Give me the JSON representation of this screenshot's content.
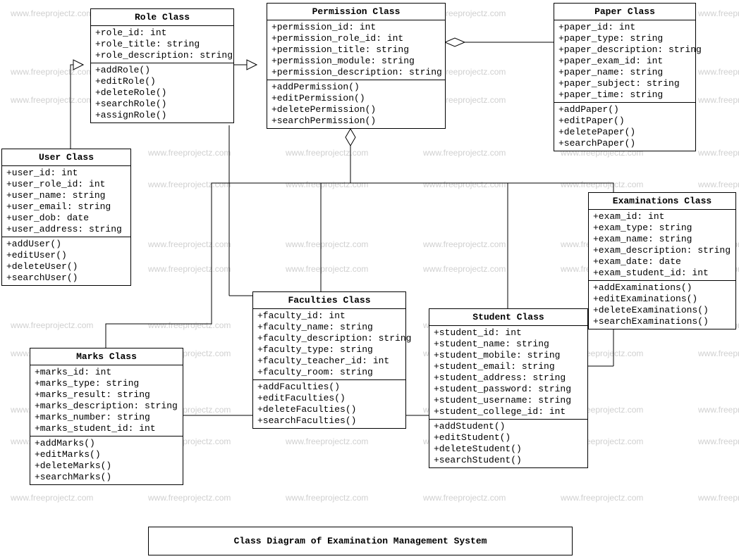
{
  "watermark": "www.freeprojectz.com",
  "caption": "Class Diagram of Examination Management System",
  "classes": {
    "role": {
      "title": "Role Class",
      "attrs": [
        "+role_id: int",
        "+role_title: string",
        "+role_description: string"
      ],
      "ops": [
        "+addRole()",
        "+editRole()",
        "+deleteRole()",
        "+searchRole()",
        "+assignRole()"
      ]
    },
    "permission": {
      "title": "Permission Class",
      "attrs": [
        "+permission_id: int",
        "+permission_role_id: int",
        "+permission_title: string",
        "+permission_module: string",
        "+permission_description: string"
      ],
      "ops": [
        "+addPermission()",
        "+editPermission()",
        "+deletePermission()",
        "+searchPermission()"
      ]
    },
    "paper": {
      "title": "Paper Class",
      "attrs": [
        "+paper_id: int",
        "+paper_type: string",
        "+paper_description: string",
        "+paper_exam_id: int",
        "+paper_name: string",
        "+paper_subject: string",
        "+paper_time: string"
      ],
      "ops": [
        "+addPaper()",
        "+editPaper()",
        "+deletePaper()",
        "+searchPaper()"
      ]
    },
    "user": {
      "title": "User Class",
      "attrs": [
        "+user_id: int",
        "+user_role_id: int",
        "+user_name: string",
        "+user_email: string",
        "+user_dob: date",
        "+user_address: string"
      ],
      "ops": [
        "+addUser()",
        "+editUser()",
        "+deleteUser()",
        "+searchUser()"
      ]
    },
    "examinations": {
      "title": "Examinations Class",
      "attrs": [
        "+exam_id: int",
        "+exam_type: string",
        "+exam_name: string",
        "+exam_description: string",
        "+exam_date: date",
        "+exam_student_id: int"
      ],
      "ops": [
        "+addExaminations()",
        "+editExaminations()",
        "+deleteExaminations()",
        "+searchExaminations()"
      ]
    },
    "faculties": {
      "title": "Faculties Class",
      "attrs": [
        "+faculty_id: int",
        "+faculty_name: string",
        "+faculty_description: string",
        "+faculty_type: string",
        "+faculty_teacher_id: int",
        "+faculty_room: string"
      ],
      "ops": [
        "+addFaculties()",
        "+editFaculties()",
        "+deleteFaculties()",
        "+searchFaculties()"
      ]
    },
    "student": {
      "title": "Student Class",
      "attrs": [
        "+student_id: int",
        "+student_name: string",
        "+student_mobile: string",
        "+student_email: string",
        "+student_address: string",
        "+student_password: string",
        "+student_username: string",
        "+student_college_id: int"
      ],
      "ops": [
        "+addStudent()",
        "+editStudent()",
        "+deleteStudent()",
        "+searchStudent()"
      ]
    },
    "marks": {
      "title": "Marks Class",
      "attrs": [
        "+marks_id: int",
        "+marks_type: string",
        "+marks_result: string",
        "+marks_description: string",
        "+marks_number: string",
        "+marks_student_id: int"
      ],
      "ops": [
        "+addMarks()",
        "+editMarks()",
        "+deleteMarks()",
        "+searchMarks()"
      ]
    }
  }
}
